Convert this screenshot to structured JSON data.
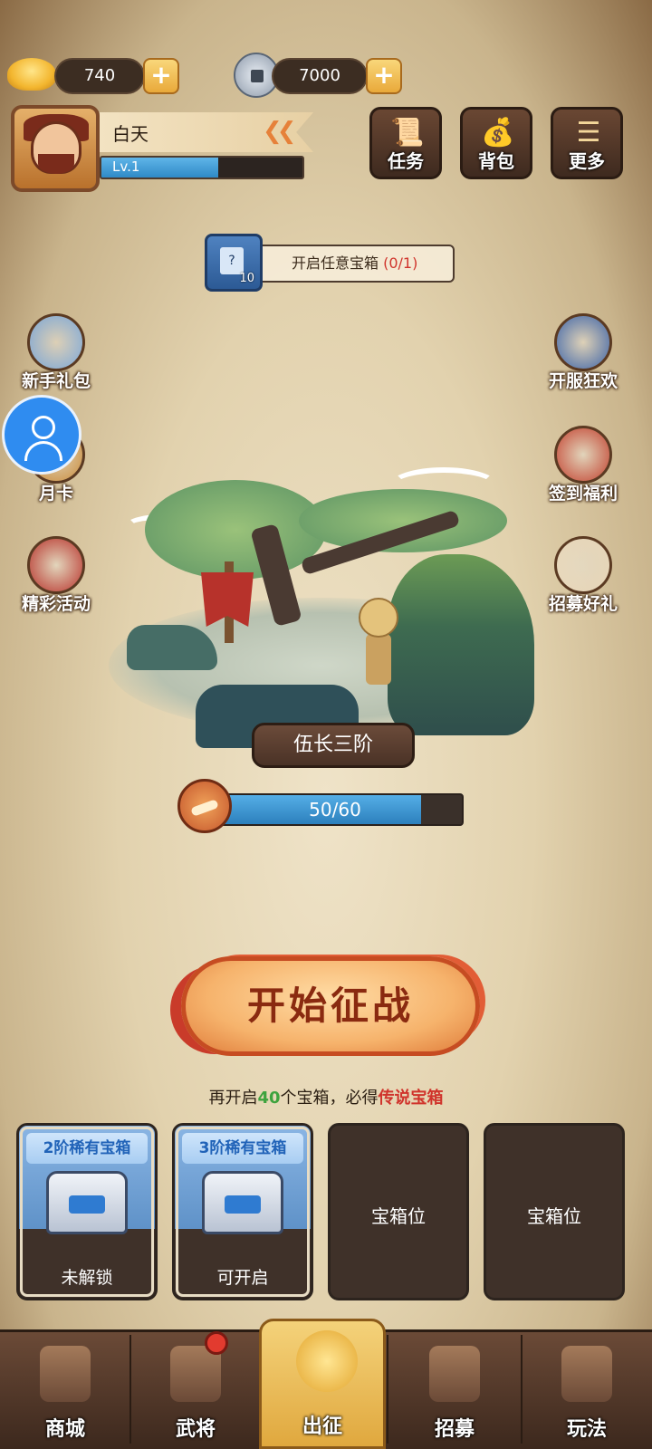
{
  "currency": {
    "gold": "740",
    "silver": "7000",
    "add_symbol": "+"
  },
  "player": {
    "name": "白天",
    "level": "Lv.1",
    "exp_fraction": 0.58
  },
  "top_buttons": [
    {
      "label": "任务",
      "icon": "scroll-icon"
    },
    {
      "label": "背包",
      "icon": "bag-icon"
    },
    {
      "label": "更多",
      "icon": "menu-icon"
    }
  ],
  "quest": {
    "text": "开启任意宝箱 ",
    "progress": "(0/1)",
    "icon_symbol": "?",
    "icon_count": "10"
  },
  "left_icons": [
    {
      "label": "新手礼包",
      "color": "#7aa6d8"
    },
    {
      "label": "月卡",
      "color": "#c98b3a"
    },
    {
      "label": "精彩活动",
      "color": "#b8322b"
    }
  ],
  "right_icons": [
    {
      "label": "开服狂欢",
      "color": "#3d64a8"
    },
    {
      "label": "签到福利",
      "color": "#c3412f"
    },
    {
      "label": "招募好礼",
      "color": "#e8d6b8"
    }
  ],
  "stage": {
    "name": "伍长三阶",
    "progress_text": "50/60",
    "progress_fraction": 0.833
  },
  "start_button": "开始征战",
  "chest_hint": {
    "prefix": "再开启",
    "count": "40",
    "middle": "个宝箱，必得",
    "reward": "传说宝箱"
  },
  "slots": [
    {
      "title": "2阶稀有宝箱",
      "state": "未解锁"
    },
    {
      "title": "3阶稀有宝箱",
      "state": "可开启"
    },
    {
      "empty": "宝箱位"
    },
    {
      "empty": "宝箱位"
    }
  ],
  "nav": [
    {
      "label": "商城"
    },
    {
      "label": "武将"
    },
    {
      "label": "出征"
    },
    {
      "label": "招募"
    },
    {
      "label": "玩法"
    }
  ],
  "colors": {
    "accent_orange": "#e6813a",
    "hint_green": "#3ea33e",
    "hint_red": "#d0342c",
    "bar_blue": "#2f8ac7"
  }
}
